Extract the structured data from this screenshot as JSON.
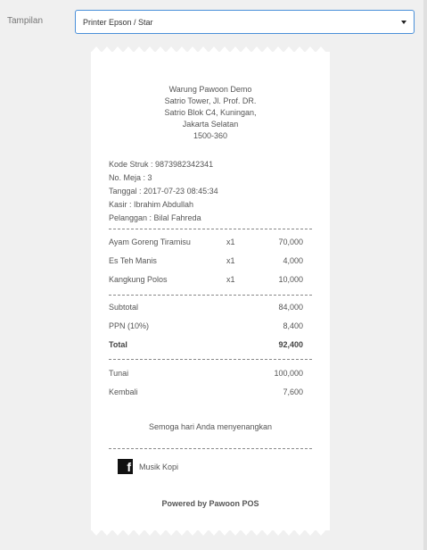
{
  "settings": {
    "label": "Tampilan",
    "selected_printer": "Printer Epson / Star"
  },
  "receipt": {
    "store_lines": [
      "Warung Pawoon Demo",
      "Satrio Tower, Jl. Prof. DR.",
      "Satrio Blok C4, Kuningan,",
      "Jakarta Selatan",
      "1500-360"
    ],
    "info_lines": [
      "Kode Struk : 9873982342341",
      "No. Meja : 3",
      "Tanggal : 2017-07-23 08:45:34",
      "Kasir : Ibrahim Abdullah",
      "Pelanggan : Bilal Fahreda"
    ],
    "items": [
      {
        "name": "Ayam Goreng Tiramisu",
        "qty": "x1",
        "amount": "70,000"
      },
      {
        "name": "Es Teh Manis",
        "qty": "x1",
        "amount": "4,000"
      },
      {
        "name": "Kangkung Polos",
        "qty": "x1",
        "amount": "10,000"
      }
    ],
    "subtotal_label": "Subtotal",
    "subtotal": "84,000",
    "tax_label": "PPN (10%)",
    "tax": "8,400",
    "total_label": "Total",
    "total": "92,400",
    "cash_label": "Tunai",
    "cash": "100,000",
    "change_label": "Kembali",
    "change": "7,600",
    "thanks": "Semoga hari Anda menyenangkan",
    "social_icon": "facebook-icon",
    "social_name": "Musik Kopi",
    "powered_by": "Powered by Pawoon POS"
  }
}
